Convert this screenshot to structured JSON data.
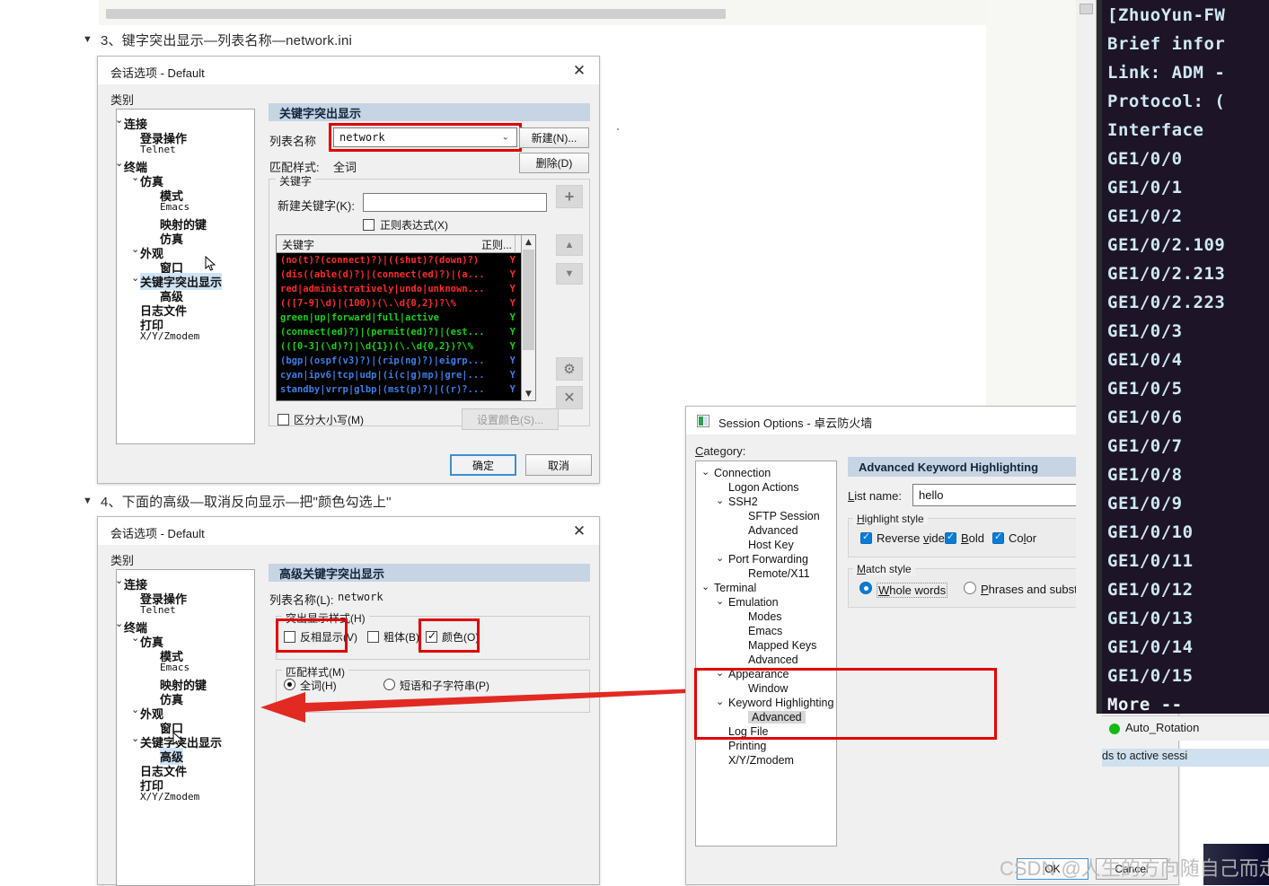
{
  "document": {
    "heading_3": "3、键字突出显示—列表名称—network.ini",
    "heading_4": "4、下面的高级—取消反向显示—把\"颜色勾选上\"",
    "triangle_glyph": "▼"
  },
  "dialog1": {
    "title": "会话选项 - Default",
    "close_glyph": "✕",
    "category_label": "类别",
    "tree": [
      {
        "label": "连接",
        "indent": 0,
        "chevron": "⌄",
        "style": "cjk",
        "selected": false
      },
      {
        "label": "登录操作",
        "indent": 1,
        "chevron": "",
        "style": "cjk",
        "selected": false
      },
      {
        "label": "Telnet",
        "indent": 1,
        "chevron": "",
        "style": "mono",
        "selected": false
      },
      {
        "label": "终端",
        "indent": 0,
        "chevron": "⌄",
        "style": "cjk",
        "selected": false
      },
      {
        "label": "仿真",
        "indent": 1,
        "chevron": "⌄",
        "style": "cjk",
        "selected": false
      },
      {
        "label": "模式",
        "indent": 2,
        "chevron": "",
        "style": "cjk",
        "selected": false
      },
      {
        "label": "Emacs",
        "indent": 2,
        "chevron": "",
        "style": "mono",
        "selected": false
      },
      {
        "label": "映射的键",
        "indent": 2,
        "chevron": "",
        "style": "cjk",
        "selected": false
      },
      {
        "label": "仿真",
        "indent": 2,
        "chevron": "",
        "style": "cjk",
        "selected": false
      },
      {
        "label": "外观",
        "indent": 1,
        "chevron": "⌄",
        "style": "cjk",
        "selected": false
      },
      {
        "label": "窗口",
        "indent": 2,
        "chevron": "",
        "style": "cjk",
        "selected": false
      },
      {
        "label": "关键字突出显示",
        "indent": 1,
        "chevron": "⌄",
        "style": "cjk",
        "selected": true
      },
      {
        "label": "高级",
        "indent": 2,
        "chevron": "",
        "style": "cjk",
        "selected": false
      },
      {
        "label": "日志文件",
        "indent": 1,
        "chevron": "",
        "style": "cjk",
        "selected": false
      },
      {
        "label": "打印",
        "indent": 1,
        "chevron": "",
        "style": "cjk",
        "selected": false
      },
      {
        "label": "X/Y/Zmodem",
        "indent": 1,
        "chevron": "",
        "style": "mono",
        "selected": false
      }
    ],
    "pane_title": "关键字突出显示",
    "list_name_label": "列表名称",
    "list_name_value": "network",
    "combo_arrow": "⌄",
    "new_button": "新建(N)...",
    "delete_button": "删除(D)",
    "match_style_label": "匹配样式:",
    "match_style_value": "全词",
    "keyword_group_caption": "关键字",
    "new_keyword_label": "新建关键字(K):",
    "new_keyword_value": "",
    "regex_checkbox_label": "正则表达式(X)",
    "regex_checked": false,
    "list_header_keyword": "关键字",
    "list_header_regex": "正则...",
    "keyword_rows": [
      {
        "pattern": "(no(t)?(connect)?)|((shut)?(down)?)",
        "regex": "Y",
        "color": "#ff2a2a"
      },
      {
        "pattern": "(dis((able(d)?)|(connect(ed)?)|(a...",
        "regex": "Y",
        "color": "#ff2a2a"
      },
      {
        "pattern": "red|administratively|undo|unknown...",
        "regex": "Y",
        "color": "#ff2a2a"
      },
      {
        "pattern": "(([7-9]\\d)|(100))(\\.\\d{0,2})?\\%",
        "regex": "Y",
        "color": "#ff2a2a"
      },
      {
        "pattern": "green|up|forward|full|active",
        "regex": "Y",
        "color": "#19d219"
      },
      {
        "pattern": "(connect(ed)?)|(permit(ed)?)|(est...",
        "regex": "Y",
        "color": "#19d219"
      },
      {
        "pattern": "(([0-3](\\d)?)|\\d{1})(\\.\\d{0,2})?\\%",
        "regex": "Y",
        "color": "#19d219"
      },
      {
        "pattern": "(bgp|(ospf(v3)?)|(rip(ng)?)|eigrp...",
        "regex": "Y",
        "color": "#3b7fe8"
      },
      {
        "pattern": "cyan|ipv6|tcp|udp|(i(c|g)mp)|gre|...",
        "regex": "Y",
        "color": "#3b7fe8"
      },
      {
        "pattern": "standby|vrrp|glbp|(mst(p)?)|((r)?...",
        "regex": "Y",
        "color": "#3b7fe8"
      }
    ],
    "case_sensitive_label": "区分大小写(M)",
    "case_sensitive_checked": false,
    "set_color_button": "设置颜色(S)...",
    "ok_button": "确定",
    "cancel_button": "取消",
    "side_buttons": {
      "move_up": "▲",
      "move_down": "▼",
      "settings": "⚙",
      "remove": "✕",
      "add": "+"
    }
  },
  "dialog2": {
    "title": "会话选项 - Default",
    "close_glyph": "✕",
    "category_label": "类别",
    "tree": [
      {
        "label": "连接",
        "indent": 0,
        "chevron": "⌄",
        "style": "cjk",
        "selected": false
      },
      {
        "label": "登录操作",
        "indent": 1,
        "chevron": "",
        "style": "cjk",
        "selected": false
      },
      {
        "label": "Telnet",
        "indent": 1,
        "chevron": "",
        "style": "mono",
        "selected": false
      },
      {
        "label": "终端",
        "indent": 0,
        "chevron": "⌄",
        "style": "cjk",
        "selected": false
      },
      {
        "label": "仿真",
        "indent": 1,
        "chevron": "⌄",
        "style": "cjk",
        "selected": false
      },
      {
        "label": "模式",
        "indent": 2,
        "chevron": "",
        "style": "cjk",
        "selected": false
      },
      {
        "label": "Emacs",
        "indent": 2,
        "chevron": "",
        "style": "mono",
        "selected": false
      },
      {
        "label": "映射的键",
        "indent": 2,
        "chevron": "",
        "style": "cjk",
        "selected": false
      },
      {
        "label": "仿真",
        "indent": 2,
        "chevron": "",
        "style": "cjk",
        "selected": false
      },
      {
        "label": "外观",
        "indent": 1,
        "chevron": "⌄",
        "style": "cjk",
        "selected": false
      },
      {
        "label": "窗口",
        "indent": 2,
        "chevron": "",
        "style": "cjk",
        "selected": false
      },
      {
        "label": "关键字突出显示",
        "indent": 1,
        "chevron": "⌄",
        "style": "cjk",
        "selected": false
      },
      {
        "label": "高级",
        "indent": 2,
        "chevron": "",
        "style": "cjk",
        "selected": true
      },
      {
        "label": "日志文件",
        "indent": 1,
        "chevron": "",
        "style": "cjk",
        "selected": false
      },
      {
        "label": "打印",
        "indent": 1,
        "chevron": "",
        "style": "cjk",
        "selected": false
      },
      {
        "label": "X/Y/Zmodem",
        "indent": 1,
        "chevron": "",
        "style": "mono",
        "selected": false
      }
    ],
    "pane_title": "高级关键字突出显示",
    "list_name_label": "列表名称(L):",
    "list_name_value": "network",
    "highlight_group_caption": "突出显示样式(H)",
    "reverse_label": "反相显示(V)",
    "reverse_checked": false,
    "bold_label": "粗体(B)",
    "bold_checked": false,
    "color_label": "颜色(O)",
    "color_checked": true,
    "match_group_caption": "匹配样式(M)",
    "whole_word_label": "全词(H)",
    "whole_word_selected": true,
    "phrase_label": "短语和子字符串(P)",
    "phrase_selected": false
  },
  "session_options": {
    "title": "Session Options - 卓云防火墙",
    "close_glyph": "✕",
    "category_label": "Category:",
    "tree": [
      {
        "label": "Connection",
        "indent": 0,
        "chevron": "⌄",
        "selected": false
      },
      {
        "label": "Logon Actions",
        "indent": 1,
        "chevron": "",
        "selected": false
      },
      {
        "label": "SSH2",
        "indent": 1,
        "chevron": "⌄",
        "selected": false
      },
      {
        "label": "SFTP Session",
        "indent": 2,
        "chevron": "",
        "selected": false
      },
      {
        "label": "Advanced",
        "indent": 2,
        "chevron": "",
        "selected": false
      },
      {
        "label": "Host Key",
        "indent": 2,
        "chevron": "",
        "selected": false
      },
      {
        "label": "Port Forwarding",
        "indent": 1,
        "chevron": "⌄",
        "selected": false
      },
      {
        "label": "Remote/X11",
        "indent": 2,
        "chevron": "",
        "selected": false
      },
      {
        "label": "Terminal",
        "indent": 0,
        "chevron": "⌄",
        "selected": false
      },
      {
        "label": "Emulation",
        "indent": 1,
        "chevron": "⌄",
        "selected": false
      },
      {
        "label": "Modes",
        "indent": 2,
        "chevron": "",
        "selected": false
      },
      {
        "label": "Emacs",
        "indent": 2,
        "chevron": "",
        "selected": false
      },
      {
        "label": "Mapped Keys",
        "indent": 2,
        "chevron": "",
        "selected": false
      },
      {
        "label": "Advanced",
        "indent": 2,
        "chevron": "",
        "selected": false
      },
      {
        "label": "Appearance",
        "indent": 1,
        "chevron": "⌄",
        "selected": false
      },
      {
        "label": "Window",
        "indent": 2,
        "chevron": "",
        "selected": false
      },
      {
        "label": "Keyword Highlighting",
        "indent": 1,
        "chevron": "⌄",
        "selected": false
      },
      {
        "label": "Advanced",
        "indent": 2,
        "chevron": "",
        "selected": true
      },
      {
        "label": "Log File",
        "indent": 1,
        "chevron": "",
        "selected": false
      },
      {
        "label": "Printing",
        "indent": 1,
        "chevron": "",
        "selected": false
      },
      {
        "label": "X/Y/Zmodem",
        "indent": 1,
        "chevron": "",
        "selected": false
      }
    ],
    "pane_title": "Advanced Keyword Highlighting",
    "list_name_label": "List name:",
    "list_name_value": "hello",
    "highlight_group_caption": "Highlight style",
    "reverse_label": "Reverse video",
    "reverse_checked": true,
    "bold_label": "Bold",
    "bold_checked": true,
    "color_label": "Color",
    "color_checked": true,
    "match_group_caption": "Match style",
    "whole_words_label": "Whole words",
    "whole_words_selected": true,
    "phrases_label": "Phrases and substrings",
    "phrases_selected": false,
    "ok_button": "OK",
    "cancel_button": "Cancel"
  },
  "terminal": {
    "lines": [
      "[ZhuoYun-FW",
      "Brief infor",
      "Link: ADM -",
      "Protocol: (",
      "Interface",
      "GE1/0/0",
      "GE1/0/1",
      "GE1/0/2",
      "GE1/0/2.109",
      "GE1/0/2.213",
      "GE1/0/2.223",
      "GE1/0/3",
      "GE1/0/4",
      "GE1/0/5",
      "GE1/0/6",
      "GE1/0/7",
      "GE1/0/8",
      "GE1/0/9",
      "GE1/0/10",
      "GE1/0/11",
      "GE1/0/12",
      "GE1/0/13",
      "GE1/0/14",
      "GE1/0/15",
      "More  --"
    ],
    "status_label": "Auto_Rotation",
    "status_color": "#14b914",
    "hint_text": "ds to active sessi"
  },
  "watermark": "CSDN @人生的方向随自己而走"
}
